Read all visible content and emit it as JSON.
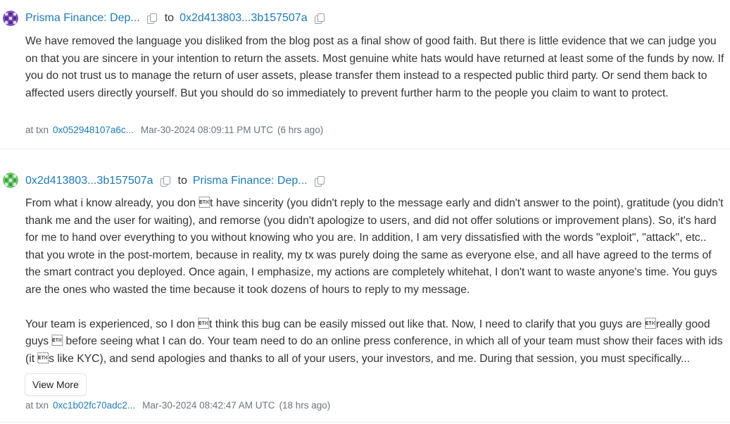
{
  "messages": [
    {
      "from": "Prisma Finance: Dep...",
      "to_word": "to",
      "to": "0x2d413803...3b157507a",
      "body": "We have removed the language you disliked from the blog post as a final show of good faith. But there is little evidence that we can judge you on that you are sincere in your intention to return the assets. Most genuine white hats would have returned at least some of the funds by now. If you do not trust us to manage the return of user assets, please transfer them instead to a respected public third party. Or send them back to affected users directly yourself. But you should do so immediately to prevent further harm to the people you claim to want to protect.",
      "at_txn": "at txn",
      "txn": "0x052948107a6c...",
      "timestamp": "Mar-30-2024 08:09:11 PM UTC",
      "ago": "(6 hrs ago)"
    },
    {
      "from": "0x2d413803...3b157507a",
      "to_word": "to",
      "to": "Prisma Finance: Dep...",
      "body": "From what i know already, you don \u0003t have sincerity (you didn't reply to the message early and didn't answer to the point), gratitude (you didn't thank me and the user for waiting), and remorse (you didn't apologize to users, and did not offer solutions or improvement plans). So, it's hard for me to hand over everything to you without knowing who you are. In addition, I am very dissatisfied with the words \"exploit\", \"attack\", etc.. that you wrote in the post-mortem, because in reality, my tx was purely doing the same as everyone else, and all have agreed to the terms of the smart contract you deployed. Once again, I emphasize, my actions are completely whitehat, I don't want to waste anyone's time. You guys are the ones who wasted the time because it took dozens of hours to reply to my message.\n\nYour team is experienced, so I don \u0003t think this bug can be easily missed out like that. Now, I need to clarify that you guys are \u0003really good guys \u0003 before seeing what I can do. Your team need to do an online press conference, in which all of your team must show their faces with ids (it \u0003s like KYC), and send apologies and thanks to all of your users, your investors, and me. During that session, you must specifically...",
      "view_more": "View More",
      "at_txn": "at txn",
      "txn": "0xc1b02fc70adc2...",
      "timestamp": "Mar-30-2024 08:42:47 AM UTC",
      "ago": "(18 hrs ago)"
    }
  ]
}
